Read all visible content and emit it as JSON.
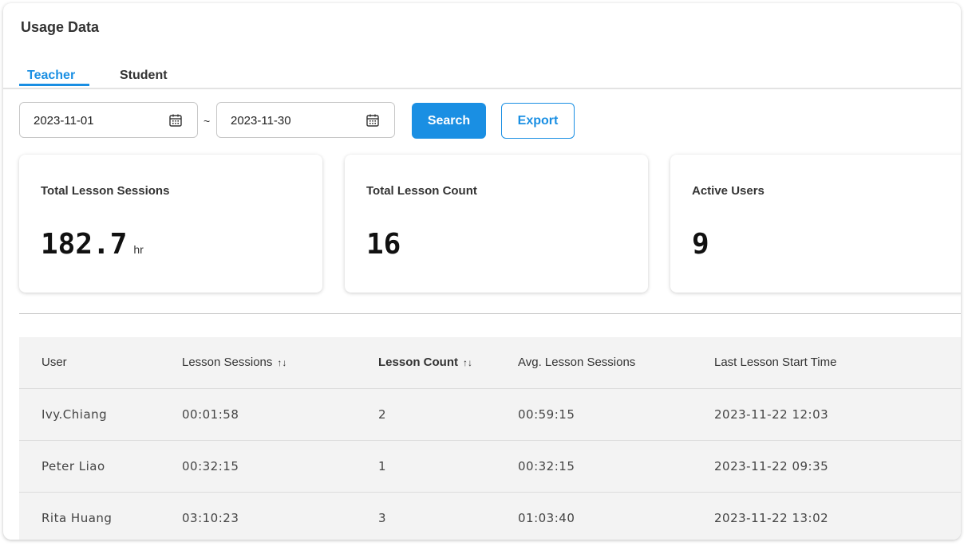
{
  "page": {
    "title": "Usage Data"
  },
  "tabs": [
    {
      "label": "Teacher",
      "active": true
    },
    {
      "label": "Student",
      "active": false
    }
  ],
  "filters": {
    "start_date": "2023-11-01",
    "separator": "~",
    "end_date": "2023-11-30",
    "search_label": "Search",
    "export_label": "Export"
  },
  "cards": [
    {
      "label": "Total Lesson Sessions",
      "value": "182.7",
      "unit": "hr"
    },
    {
      "label": "Total Lesson Count",
      "value": "16",
      "unit": ""
    },
    {
      "label": "Active Users",
      "value": "9",
      "unit": ""
    }
  ],
  "table": {
    "headers": [
      "User",
      "Lesson Sessions",
      "Lesson Count",
      "Avg. Lesson Sessions",
      "Last Lesson Start Time"
    ],
    "sort_glyph": "↑↓",
    "rows": [
      [
        "Ivy.Chiang",
        "00:01:58",
        "2",
        "00:59:15",
        "2023-11-22 12:03"
      ],
      [
        "Peter Liao",
        "00:32:15",
        "1",
        "00:32:15",
        "2023-11-22 09:35"
      ],
      [
        "Rita Huang",
        "03:10:23",
        "3",
        "01:03:40",
        "2023-11-22 13:02"
      ]
    ]
  },
  "colors": {
    "accent": "#1a8fe3",
    "table_bg": "#f3f3f3"
  }
}
